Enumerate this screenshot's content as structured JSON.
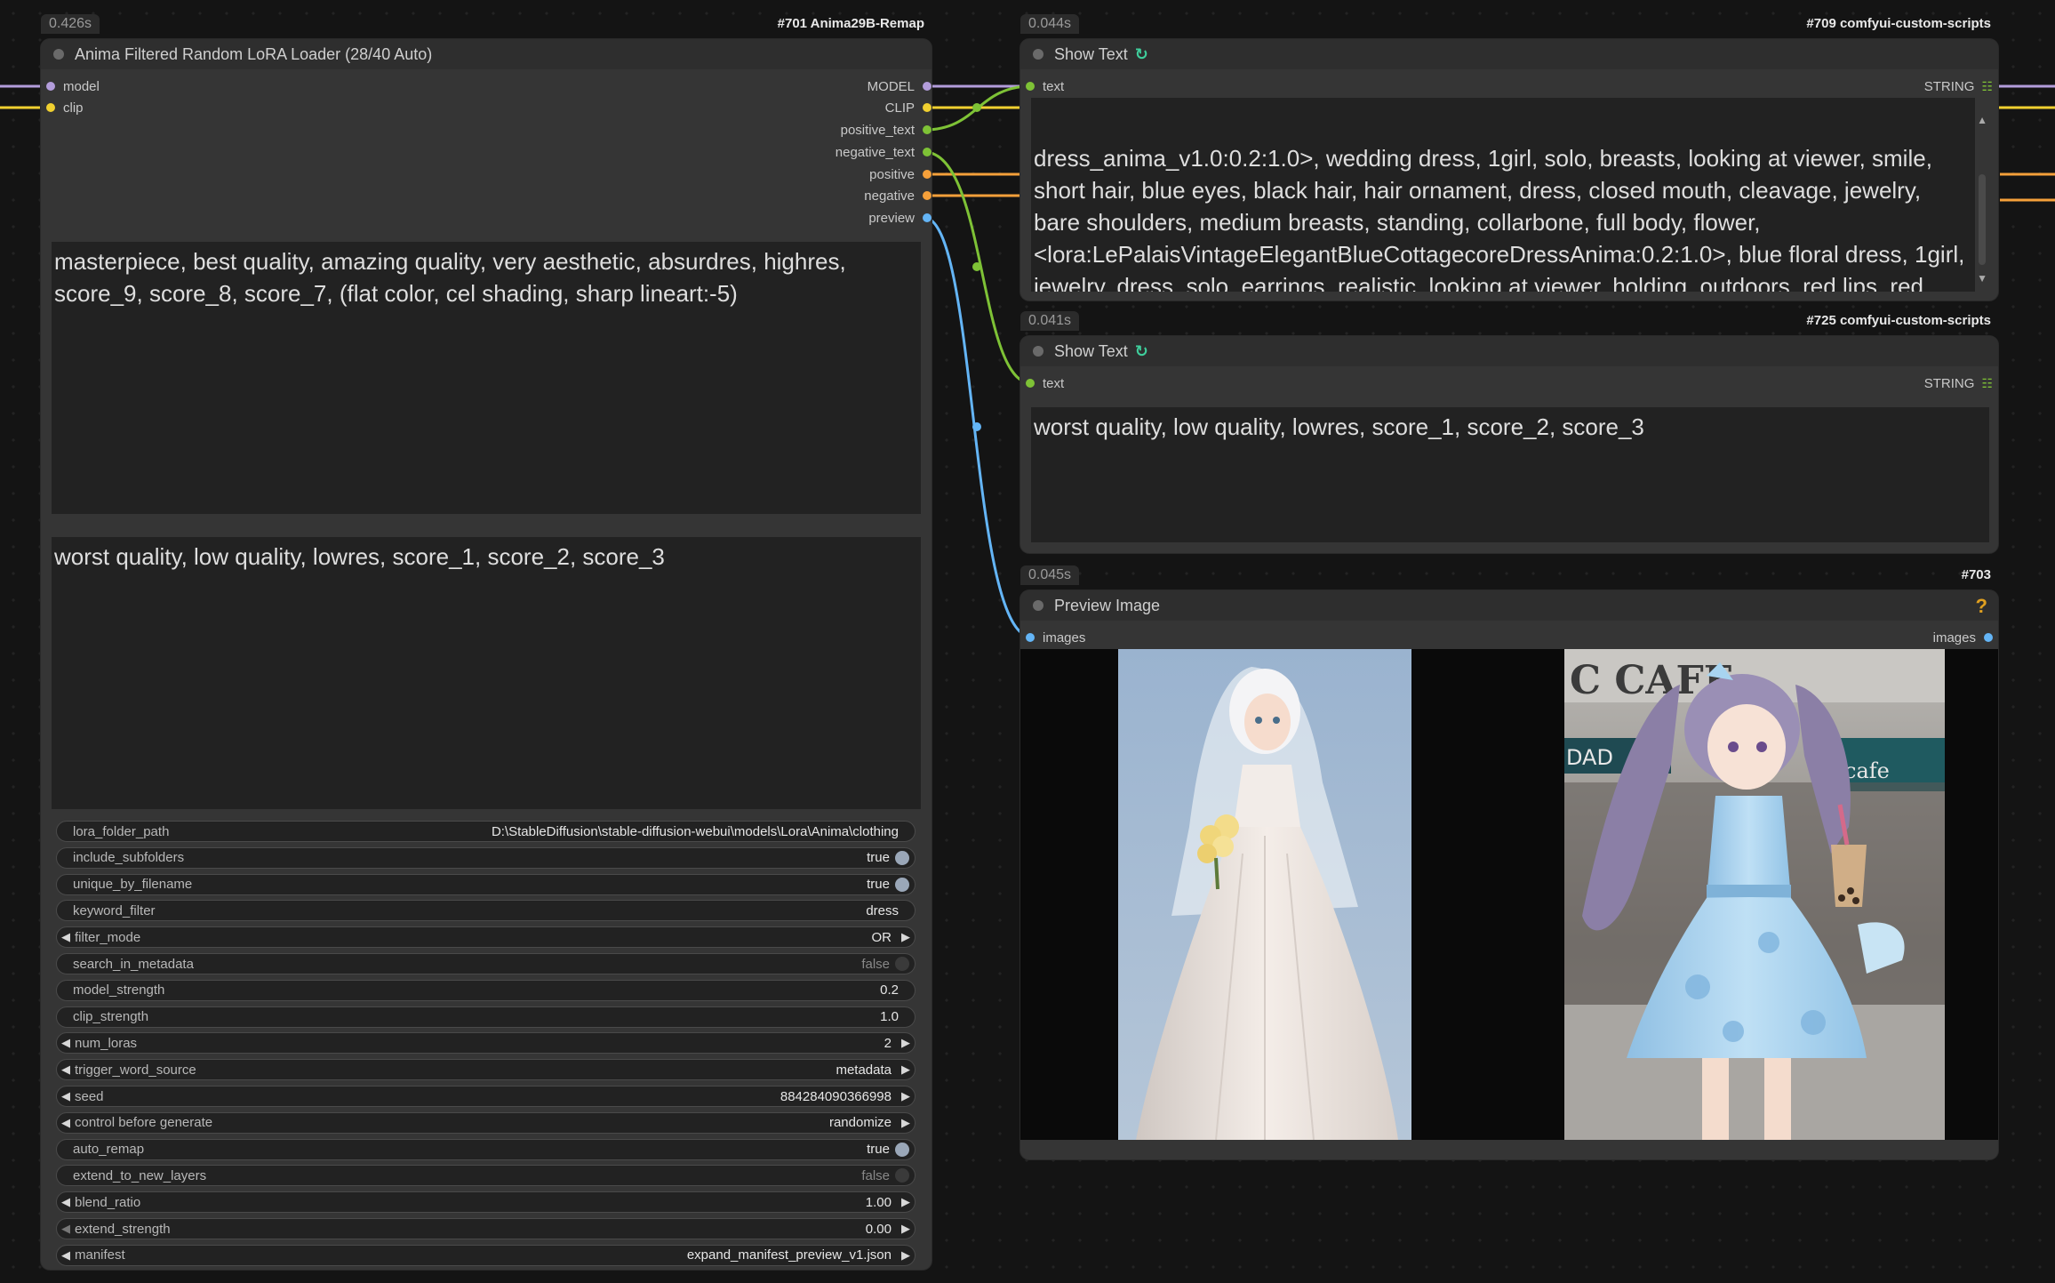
{
  "loader_node": {
    "time": "0.426s",
    "id_badge": "#701 Anima29B-Remap",
    "title": "Anima Filtered Random LoRA Loader (28/40 Auto)",
    "inputs": [
      "model",
      "clip"
    ],
    "outputs": [
      "MODEL",
      "CLIP",
      "positive_text",
      "negative_text",
      "positive",
      "negative",
      "preview"
    ],
    "positive_prompt": "masterpiece, best quality, amazing quality, very aesthetic, absurdres, highres, score_9, score_8, score_7, (flat color, cel shading, sharp lineart:-5)",
    "negative_prompt": "worst quality, low quality, lowres, score_1, score_2, score_3",
    "widgets": [
      {
        "name": "lora_folder_path",
        "value": "D:\\StableDiffusion\\stable-diffusion-webui\\models\\Lora\\Anima\\clothing",
        "kind": "text"
      },
      {
        "name": "include_subfolders",
        "value": "true",
        "kind": "toggle_on"
      },
      {
        "name": "unique_by_filename",
        "value": "true",
        "kind": "toggle_on"
      },
      {
        "name": "keyword_filter",
        "value": "dress",
        "kind": "text"
      },
      {
        "name": "filter_mode",
        "value": "OR",
        "kind": "combo"
      },
      {
        "name": "search_in_metadata",
        "value": "false",
        "kind": "toggle_off"
      },
      {
        "name": "model_strength",
        "value": "0.2",
        "kind": "text"
      },
      {
        "name": "clip_strength",
        "value": "1.0",
        "kind": "text"
      },
      {
        "name": "num_loras",
        "value": "2",
        "kind": "number"
      },
      {
        "name": "trigger_word_source",
        "value": "metadata",
        "kind": "combo"
      },
      {
        "name": "seed",
        "value": "884284090366998",
        "kind": "number"
      },
      {
        "name": "control before generate",
        "value": "randomize",
        "kind": "combo"
      },
      {
        "name": "auto_remap",
        "value": "true",
        "kind": "toggle_on"
      },
      {
        "name": "extend_to_new_layers",
        "value": "false",
        "kind": "toggle_off"
      },
      {
        "name": "blend_ratio",
        "value": "1.00",
        "kind": "number"
      },
      {
        "name": "extend_strength",
        "value": "0.00",
        "kind": "number_faint"
      },
      {
        "name": "manifest",
        "value": "expand_manifest_preview_v1.json",
        "kind": "combo"
      }
    ]
  },
  "show_text_1": {
    "time": "0.044s",
    "id_badge": "#709 comfyui-custom-scripts",
    "title": "Show Text",
    "input": "text",
    "output": "STRING",
    "content": "dress_anima_v1.0:0.2:1.0>, wedding dress, 1girl, solo, breasts, looking at viewer, smile, short hair, blue eyes, black hair, hair ornament, dress, closed mouth, cleavage, jewelry, bare shoulders, medium breasts, standing, collarbone, full body, flower, <lora:LePalaisVintageElegantBlueCottagecoreDressAnima:0.2:1.0>, blue floral dress, 1girl, jewelry, dress, solo, earrings, realistic, looking at viewer, holding, outdoors, red lips, red hair, blue dress, standing, makeup, closed eyes, photo background, mole, smile, skirt hold"
  },
  "show_text_2": {
    "time": "0.041s",
    "id_badge": "#725 comfyui-custom-scripts",
    "title": "Show Text",
    "input": "text",
    "output": "STRING",
    "content": "worst quality, low quality, lowres, score_1, score_2, score_3"
  },
  "preview_node": {
    "time": "0.045s",
    "id_badge": "#703",
    "title": "Preview Image",
    "input": "images",
    "output": "images",
    "help_icon": "question-icon",
    "sign_text_1": "C CAFE",
    "sign_text_2": "cafe",
    "sign_text_3": "DAD"
  },
  "colors": {
    "model": "#b39ddb",
    "clip": "#f0d030",
    "string": "#7ec236",
    "conditioning": "#f5a03a",
    "image": "#64b5f6",
    "node_body": "#353535",
    "canvas": "#141414"
  }
}
